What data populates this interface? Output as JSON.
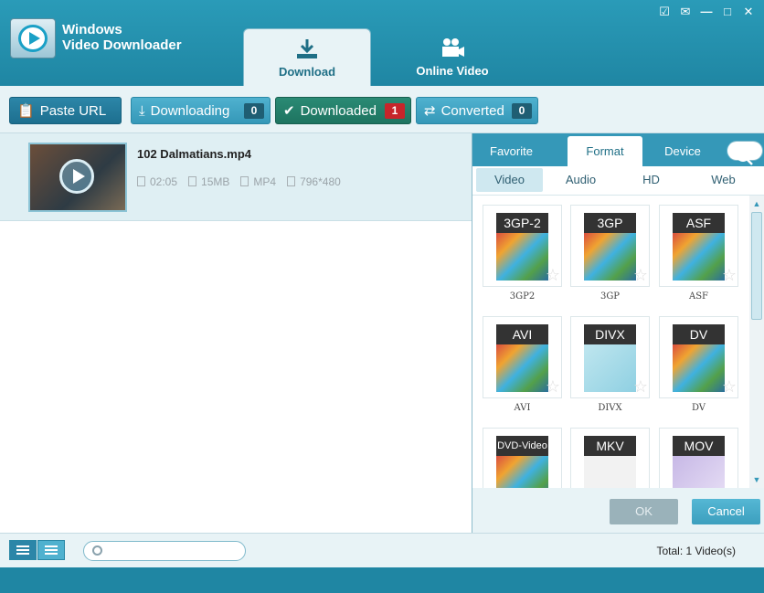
{
  "app": {
    "title_line1": "Windows",
    "title_line2": "Video Downloader"
  },
  "window_controls": [
    "register-icon",
    "feedback-icon",
    "menu-icon",
    "maximize-icon",
    "close-icon"
  ],
  "main_tabs": [
    {
      "label": "Download",
      "icon": "download-icon",
      "active": true
    },
    {
      "label": "Online Video",
      "icon": "video-camera-icon",
      "active": false
    }
  ],
  "toolbar": {
    "paste_url": "Paste URL",
    "downloading": {
      "label": "Downloading",
      "count": "0"
    },
    "downloaded": {
      "label": "Downloaded",
      "count": "1"
    },
    "converted": {
      "label": "Converted",
      "count": "0"
    }
  },
  "items": [
    {
      "filename": "102 Dalmatians.mp4",
      "duration": "02:05",
      "size": "15MB",
      "format": "MP4",
      "resolution": "796*480"
    }
  ],
  "panel": {
    "tabs": [
      "Favorite",
      "Format",
      "Device"
    ],
    "active_tab": "Format",
    "subtabs": [
      "Video",
      "Audio",
      "HD",
      "Web"
    ],
    "active_subtab": "Video",
    "formats": [
      "3GP-2",
      "3GP",
      "ASF",
      "AVI",
      "DIVX",
      "DV",
      "DVD-Video",
      "MKV",
      "MOV"
    ],
    "labels": [
      "3GP2",
      "3GP",
      "ASF",
      "AVI",
      "DIVX",
      "DV"
    ],
    "ok": "OK",
    "cancel": "Cancel"
  },
  "footer": {
    "search_placeholder": "",
    "total": "Total: 1 Video(s)"
  }
}
